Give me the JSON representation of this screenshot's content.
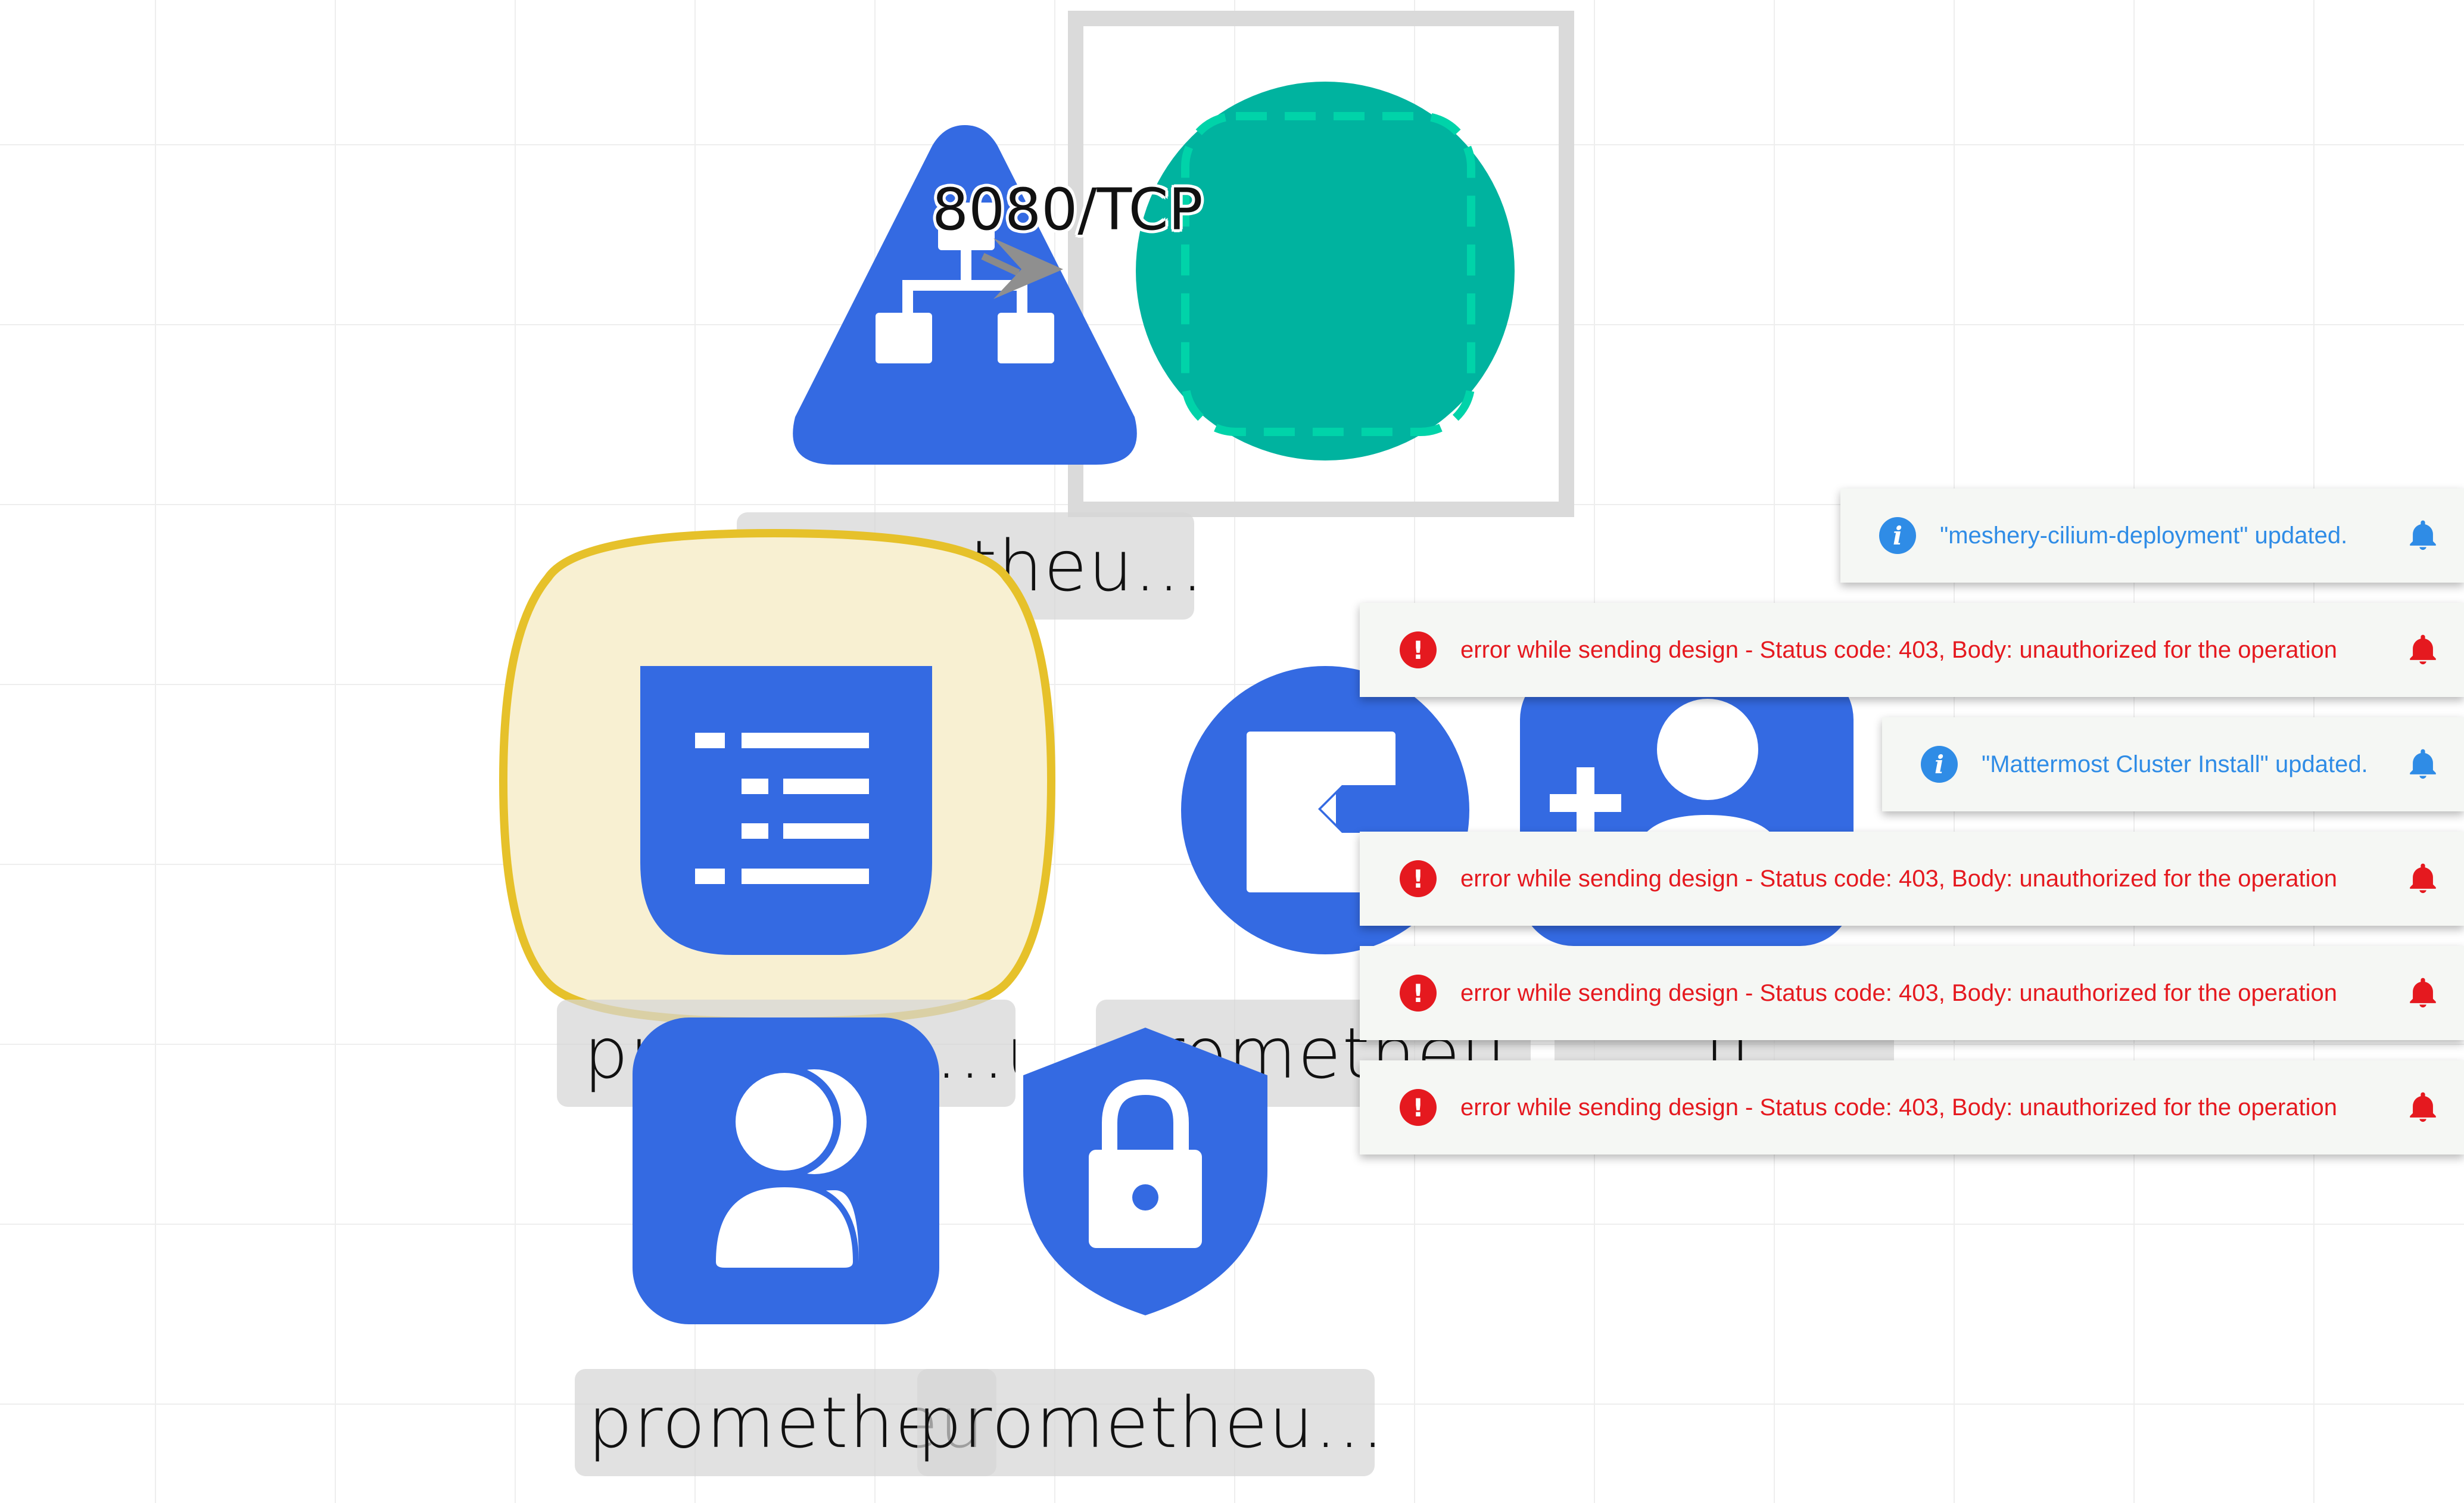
{
  "canvas": {
    "edge": {
      "label": "8080/TCP"
    },
    "nodes": [
      {
        "id": "service",
        "icon": "service-icon",
        "label": "prometheu..."
      },
      {
        "id": "pod",
        "icon": "pod-icon",
        "label": ""
      },
      {
        "id": "configmap",
        "icon": "configmap-icon",
        "label": "promethe...u..."
      },
      {
        "id": "endpoint",
        "icon": "endpoint-icon",
        "label": "prometheu"
      },
      {
        "id": "user-add",
        "icon": "user-add-icon",
        "label": "...u"
      },
      {
        "id": "service-account",
        "icon": "service-account-icon",
        "label": "prometheu"
      },
      {
        "id": "secret",
        "icon": "secret-lock-icon",
        "label": "prometheu..."
      }
    ]
  },
  "notifications": [
    {
      "type": "info",
      "message": "\"meshery-cilium-deployment\" updated."
    },
    {
      "type": "error",
      "message": "error while sending design - Status code: 403, Body: unauthorized for the operation"
    },
    {
      "type": "info",
      "message": "\"Mattermost Cluster Install\" updated."
    },
    {
      "type": "error",
      "message": "error while sending design - Status code: 403, Body: unauthorized for the operation"
    },
    {
      "type": "error",
      "message": "error while sending design - Status code: 403, Body: unauthorized for the operation"
    },
    {
      "type": "error",
      "message": "error while sending design - Status code: 403, Body: unauthorized for the operation"
    }
  ],
  "colors": {
    "node_blue": "#346ae2",
    "pod_green": "#00b39f",
    "pod_dash": "#00d3a9",
    "highlight_fill": "#f8f0d2",
    "highlight_stroke": "#e6c12a",
    "error_red": "#e5191f",
    "info_blue": "#2f8ce6"
  }
}
